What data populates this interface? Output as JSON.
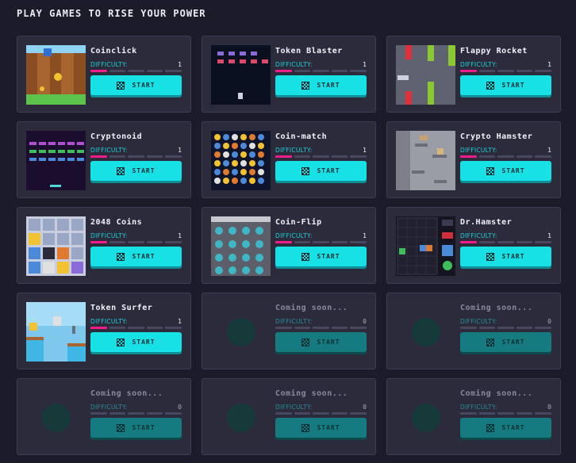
{
  "heading": "Play games to rise your power",
  "colors": {
    "background": "#1b1b29",
    "card": "#2b2b3c",
    "accent_cyan": "#18e1e6",
    "difficulty_pink": "#ef1e8c"
  },
  "start_icon": "checkered-flag-icon",
  "games": [
    {
      "title": "Coinclick",
      "difficulty_label": "DIFFICULTY:",
      "difficulty": "1",
      "level": 1,
      "start": "START"
    },
    {
      "title": "Token Blaster",
      "difficulty_label": "DIFFICULTY:",
      "difficulty": "1",
      "level": 1,
      "start": "START"
    },
    {
      "title": "Flappy Rocket",
      "difficulty_label": "DIFFICULTY:",
      "difficulty": "1",
      "level": 1,
      "start": "START"
    },
    {
      "title": "Cryptonoid",
      "difficulty_label": "DIFFICULTY:",
      "difficulty": "1",
      "level": 1,
      "start": "START"
    },
    {
      "title": "Coin-match",
      "difficulty_label": "DIFFICULTY:",
      "difficulty": "1",
      "level": 1,
      "start": "START"
    },
    {
      "title": "Crypto Hamster",
      "difficulty_label": "DIFFICULTY:",
      "difficulty": "1",
      "level": 1,
      "start": "START"
    },
    {
      "title": "2048 Coins",
      "difficulty_label": "DIFFICULTY:",
      "difficulty": "1",
      "level": 1,
      "start": "START"
    },
    {
      "title": "Coin-Flip",
      "difficulty_label": "DIFFICULTY:",
      "difficulty": "1",
      "level": 1,
      "start": "START"
    },
    {
      "title": "Dr.Hamster",
      "difficulty_label": "DIFFICULTY:",
      "difficulty": "1",
      "level": 1,
      "start": "START"
    },
    {
      "title": "Token Surfer",
      "difficulty_label": "DIFFICULTY:",
      "difficulty": "1",
      "level": 1,
      "start": "START"
    },
    {
      "title": "Coming soon...",
      "difficulty_label": "DIFFICULTY:",
      "difficulty": "0",
      "level": 0,
      "start": "START"
    },
    {
      "title": "Coming soon...",
      "difficulty_label": "DIFFICULTY:",
      "difficulty": "0",
      "level": 0,
      "start": "START"
    },
    {
      "title": "Coming soon...",
      "difficulty_label": "DIFFICULTY:",
      "difficulty": "0",
      "level": 0,
      "start": "START"
    },
    {
      "title": "Coming soon...",
      "difficulty_label": "DIFFICULTY:",
      "difficulty": "0",
      "level": 0,
      "start": "START"
    },
    {
      "title": "Coming soon...",
      "difficulty_label": "DIFFICULTY:",
      "difficulty": "0",
      "level": 0,
      "start": "START"
    }
  ]
}
